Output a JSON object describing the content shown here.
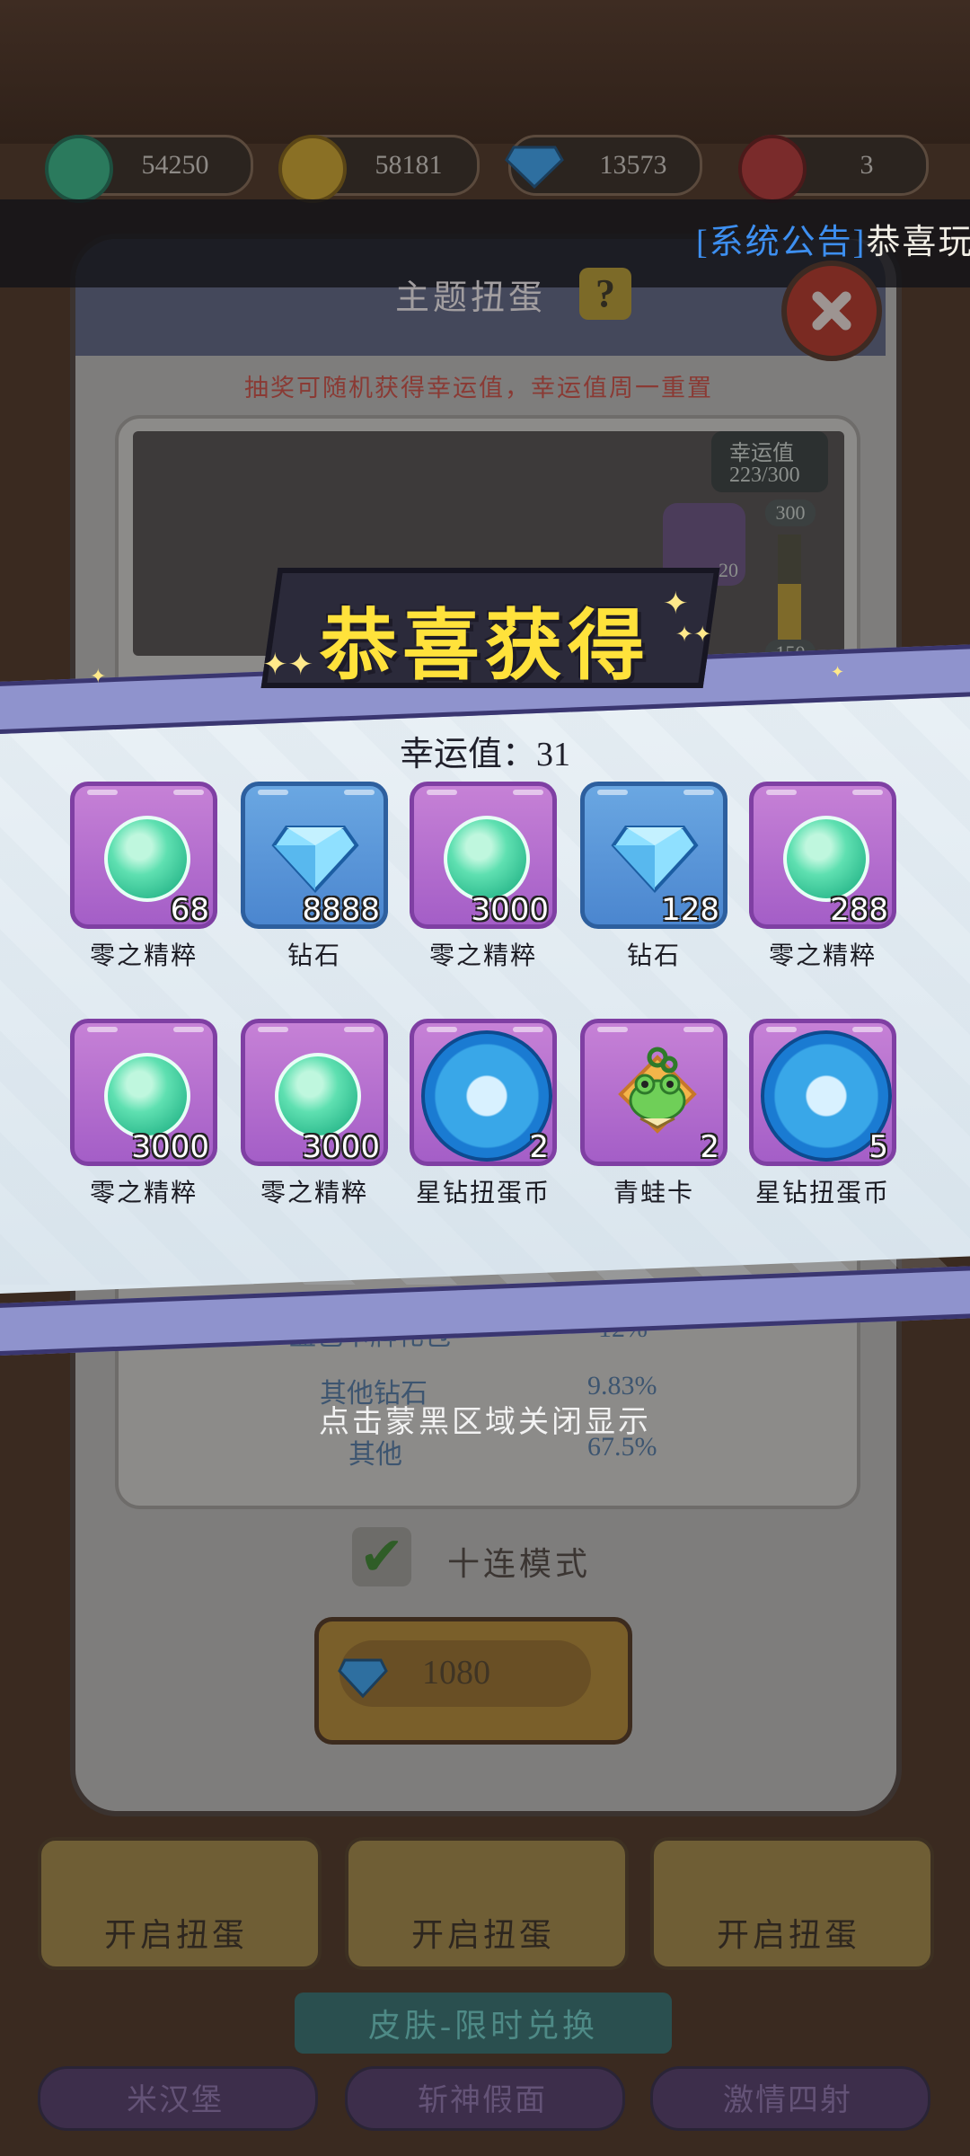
{
  "resources": [
    {
      "icon": "green-essence-icon",
      "value": "54250"
    },
    {
      "icon": "gold-coin-icon",
      "value": "58181"
    },
    {
      "icon": "diamond-icon",
      "value": "13573"
    },
    {
      "icon": "red-token-icon",
      "value": "3"
    }
  ],
  "announcement": {
    "tag": "[系统公告]",
    "message": "恭喜玩"
  },
  "modal": {
    "title": "主题扭蛋",
    "help": "?",
    "hint": "抽奖可随机获得幸运值，幸运值周一重置",
    "luck_box_label": "幸运值",
    "luck_box_value": "223/300",
    "gauge_top": "300",
    "gauge_mid": "150",
    "pool_count": "20",
    "probabilities": [
      {
        "label": "蓝色卡牌礼包",
        "value": "12%"
      },
      {
        "label": "其他钻石",
        "value": "9.83%"
      },
      {
        "label": "其他",
        "value": "67.5%"
      }
    ],
    "ten_mode_label": "十连模式",
    "cost": "1080"
  },
  "open_buttons": [
    "开启扭蛋",
    "开启扭蛋",
    "开启扭蛋"
  ],
  "skin_section": {
    "title": "皮肤-限时兑换",
    "skins": [
      "米汉堡",
      "斩神假面",
      "激情四射"
    ]
  },
  "reward": {
    "title": "恭喜获得",
    "luck_text": "幸运值：31",
    "items": [
      {
        "name": "零之精粹",
        "count": "68",
        "type": "essence"
      },
      {
        "name": "钻石",
        "count": "8888",
        "type": "diamond"
      },
      {
        "name": "零之精粹",
        "count": "3000",
        "type": "essence"
      },
      {
        "name": "钻石",
        "count": "128",
        "type": "diamond"
      },
      {
        "name": "零之精粹",
        "count": "288",
        "type": "essence"
      },
      {
        "name": "零之精粹",
        "count": "3000",
        "type": "essence"
      },
      {
        "name": "零之精粹",
        "count": "3000",
        "type": "essence"
      },
      {
        "name": "星钻扭蛋币",
        "count": "2",
        "type": "star-coin"
      },
      {
        "name": "青蛙卡",
        "count": "2",
        "type": "frog-card"
      },
      {
        "name": "星钻扭蛋币",
        "count": "5",
        "type": "star-coin"
      }
    ],
    "close_hint": "点击蒙黑区域关闭显示"
  },
  "colors": {
    "title_yellow": "#ffe23b",
    "item_purple": "#b06ccc",
    "item_blue": "#5a96d9",
    "stripe": "#8f93cd"
  }
}
